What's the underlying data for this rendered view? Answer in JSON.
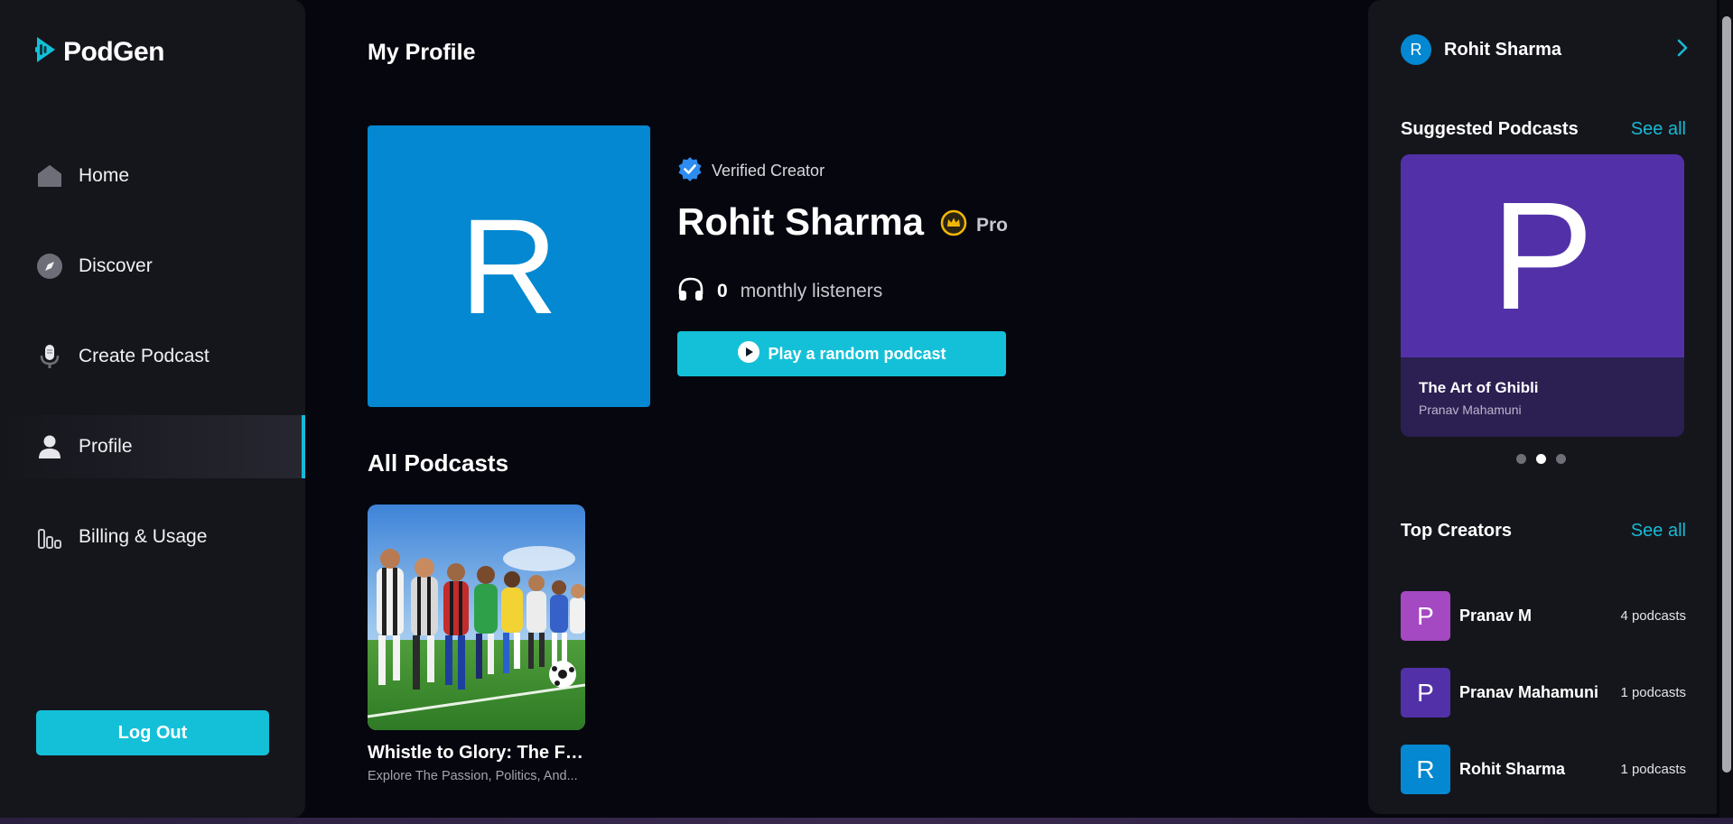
{
  "brand": {
    "name": "PodGen",
    "accent": "#14c0d8"
  },
  "sidebar": {
    "items": [
      {
        "label": "Home",
        "icon": "home-icon"
      },
      {
        "label": "Discover",
        "icon": "compass-icon"
      },
      {
        "label": "Create Podcast",
        "icon": "microphone-icon"
      },
      {
        "label": "Profile",
        "icon": "user-icon",
        "active": true
      },
      {
        "label": "Billing & Usage",
        "icon": "bar-chart-icon"
      }
    ],
    "logout_label": "Log Out"
  },
  "main": {
    "page_title": "My Profile",
    "profile": {
      "avatar_initial": "R",
      "verified_label": "Verified Creator",
      "name": "Rohit Sharma",
      "plan_label": "Pro",
      "listeners_count": "0",
      "listeners_label": "monthly listeners",
      "play_button_label": "Play a random podcast"
    },
    "all_podcasts_title": "All Podcasts",
    "podcasts": [
      {
        "title": "Whistle to Glory: The Fl...",
        "description": "Explore The Passion, Politics, And..."
      }
    ]
  },
  "right_sidebar": {
    "user": {
      "initial": "R",
      "name": "Rohit Sharma"
    },
    "suggested": {
      "title": "Suggested Podcasts",
      "see_all": "See all",
      "card": {
        "initial": "P",
        "title": "The Art of Ghibli",
        "author": "Pranav Mahamuni"
      },
      "carousel_active_index": 1,
      "carousel_count": 3
    },
    "top_creators": {
      "title": "Top Creators",
      "see_all": "See all",
      "items": [
        {
          "initial": "P",
          "name": "Pranav M",
          "count": "4 podcasts",
          "color": "#a449c2"
        },
        {
          "initial": "P",
          "name": "Pranav Mahamuni",
          "count": "1 podcasts",
          "color": "#5231a8"
        },
        {
          "initial": "R",
          "name": "Rohit Sharma",
          "count": "1 podcasts",
          "color": "#0388d1"
        }
      ]
    }
  }
}
